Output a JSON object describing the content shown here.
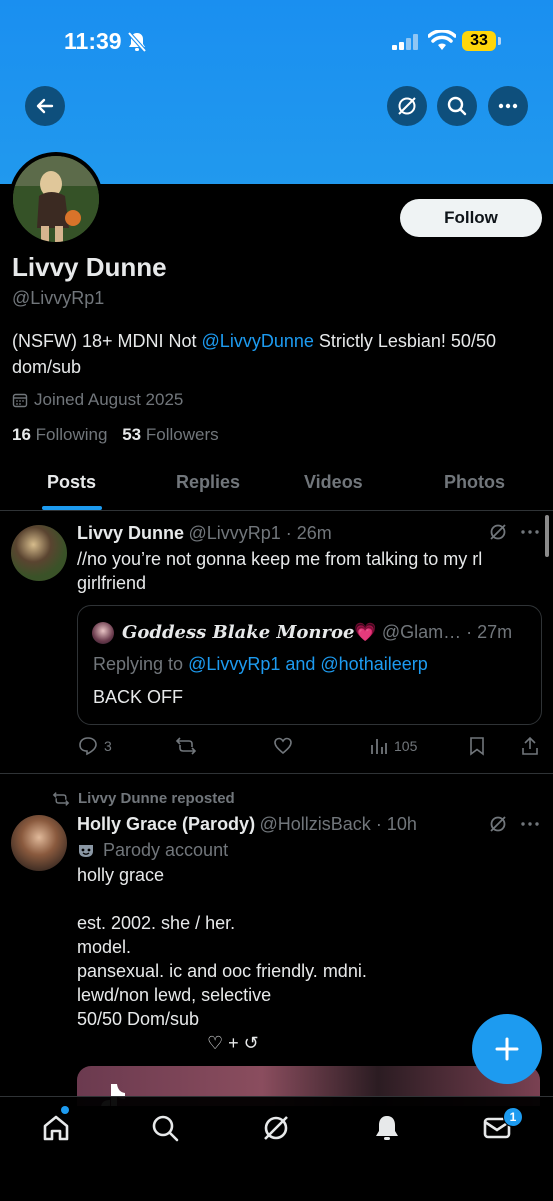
{
  "status_bar": {
    "time": "11:39",
    "battery": "33"
  },
  "profile": {
    "display_name": "Livvy Dunne",
    "handle": "@LivvyRp1",
    "follow_label": "Follow",
    "bio_prefix": "(NSFW) 18+ MDNI Not ",
    "bio_link": "@LivvyDunne",
    "bio_suffix": " Strictly Lesbian! 50/50 dom/sub",
    "joined": "Joined August 2025",
    "following_count": "16",
    "following_label": "Following",
    "followers_count": "53",
    "followers_label": "Followers"
  },
  "tabs": [
    {
      "label": "Posts",
      "active": true
    },
    {
      "label": "Replies",
      "active": false
    },
    {
      "label": "Videos",
      "active": false
    },
    {
      "label": "Photos",
      "active": false
    }
  ],
  "posts": [
    {
      "name": "Livvy Dunne",
      "meta": "@LivvyRp1 · 26m",
      "text": "//no you’re not gonna keep me from talking to my rl girlfriend",
      "quote": {
        "name": "𝑮𝒐𝒅𝒅𝒆𝒔𝒔 𝑩𝒍𝒂𝒌𝒆 𝑴𝒐𝒏𝒓𝒐𝒆",
        "heart": "💗",
        "meta": "@Glam… · 27m",
        "replying_prefix": "Replying to ",
        "replying_to": "@LivvyRp1 and @hothaileerp",
        "text": "BACK OFF"
      },
      "actions": {
        "replies": "3",
        "views": "105"
      }
    },
    {
      "repost_label": "Livvy Dunne reposted",
      "name": "Holly Grace (Parody)",
      "meta": "@HollzisBack · 10h",
      "parody_label": "Parody account",
      "text_lines": [
        "holly grace",
        "",
        "est. 2002. she / her.",
        "model.",
        "pansexual.  ic and ooc friendly.  mdni.",
        "lewd/non lewd, selective",
        "50/50 Dom/sub",
        "♡ + ↺"
      ]
    }
  ],
  "nav": {
    "messages_badge": "1"
  },
  "colors": {
    "accent": "#1d9bf0",
    "header": "#1d95ee",
    "muted": "#71767b"
  }
}
